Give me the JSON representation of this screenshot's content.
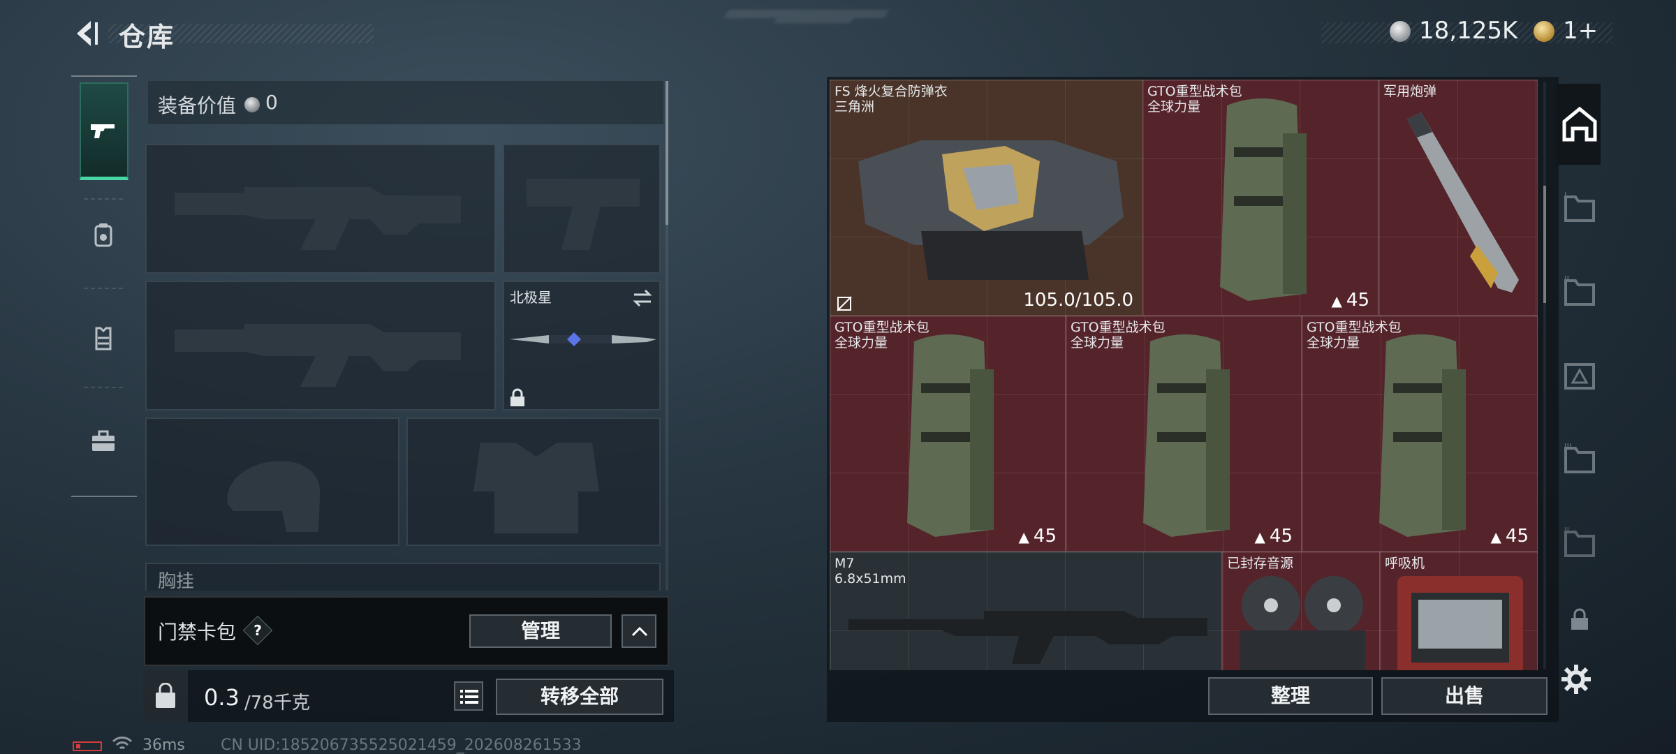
{
  "header": {
    "title": "仓库"
  },
  "currency": {
    "silver": "18,125K",
    "gold": "1+"
  },
  "left_nav": {
    "items": [
      "gun-icon",
      "backpack-icon",
      "vest-icon",
      "toolbox-icon"
    ]
  },
  "equipment": {
    "value_label": "装备价值",
    "value_amount": "0",
    "melee_name": "北极星",
    "chest_label": "胸挂",
    "chest_help": "?"
  },
  "keycard": {
    "label": "门禁卡包",
    "help": "?",
    "manage_label": "管理"
  },
  "weight": {
    "current": "0.3",
    "max": "/78千克"
  },
  "actions": {
    "transfer_all": "转移全部",
    "sort": "整理",
    "sell": "出售"
  },
  "status": {
    "ping": "36ms",
    "uid": "CN UID:185206735525021459_202608261533"
  },
  "items": [
    {
      "name": "FS 烽火复合防弹衣",
      "sub": "三角洲",
      "value": "105.0/105.0"
    },
    {
      "name": "GTO重型战术包",
      "sub": "全球力量",
      "capacity": "45"
    },
    {
      "name": "军用炮弹",
      "sub": ""
    },
    {
      "name": "GTO重型战术包",
      "sub": "全球力量",
      "capacity": "45"
    },
    {
      "name": "GTO重型战术包",
      "sub": "全球力量",
      "capacity": "45"
    },
    {
      "name": "GTO重型战术包",
      "sub": "全球力量",
      "capacity": "45"
    },
    {
      "name": "M7",
      "sub": "6.8x51mm"
    },
    {
      "name": "已封存音源",
      "sub": ""
    },
    {
      "name": "呼吸机",
      "sub": ""
    }
  ],
  "colors": {
    "accent": "#48d6a4",
    "cell_red": "#55242b",
    "cell_armor": "#4a3328",
    "cell_gun": "#2a3136"
  }
}
